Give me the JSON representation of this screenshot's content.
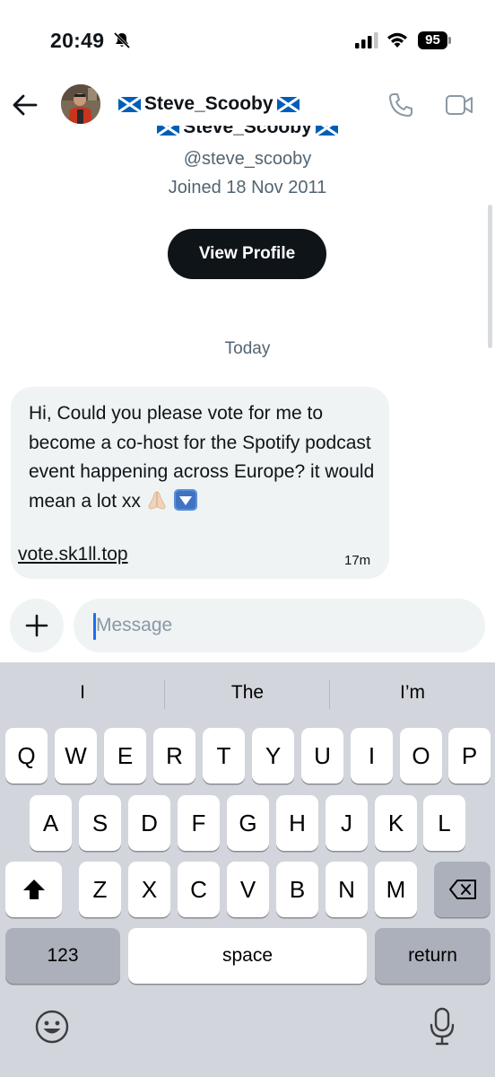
{
  "status_bar": {
    "time": "20:49",
    "battery": "95"
  },
  "header": {
    "name": "Steve_Scooby",
    "back_icon": "arrow-left-icon",
    "phone_icon": "phone-icon",
    "video_icon": "video-camera-icon"
  },
  "profile": {
    "name": "Steve_Scooby",
    "handle": "@steve_scooby",
    "joined": "Joined 18 Nov 2011",
    "view_profile_label": "View Profile"
  },
  "conversation": {
    "date_separator": "Today",
    "messages": [
      {
        "text": "Hi, Could you please vote for me to become a co-host for the Spotify podcast event happening across Europe? it would mean a lot xx",
        "emoji": [
          "folded-hands",
          "down-arrow-button"
        ],
        "link": "vote.sk1ll.top",
        "time": "17m"
      }
    ]
  },
  "composer": {
    "placeholder": "Message",
    "plus_icon": "plus-icon"
  },
  "keyboard": {
    "suggestions": [
      "I",
      "The",
      "I’m"
    ],
    "row1": [
      "Q",
      "W",
      "E",
      "R",
      "T",
      "Y",
      "U",
      "I",
      "O",
      "P"
    ],
    "row2": [
      "A",
      "S",
      "D",
      "F",
      "G",
      "H",
      "J",
      "K",
      "L"
    ],
    "row3": [
      "Z",
      "X",
      "C",
      "V",
      "B",
      "N",
      "M"
    ],
    "numbers_label": "123",
    "space_label": "space",
    "return_label": "return"
  },
  "colors": {
    "bubble": "#eff3f4",
    "button_dark": "#0f1419",
    "muted_text": "#536471",
    "caret": "#1d6ff2",
    "keyboard_bg": "#d2d5db"
  }
}
